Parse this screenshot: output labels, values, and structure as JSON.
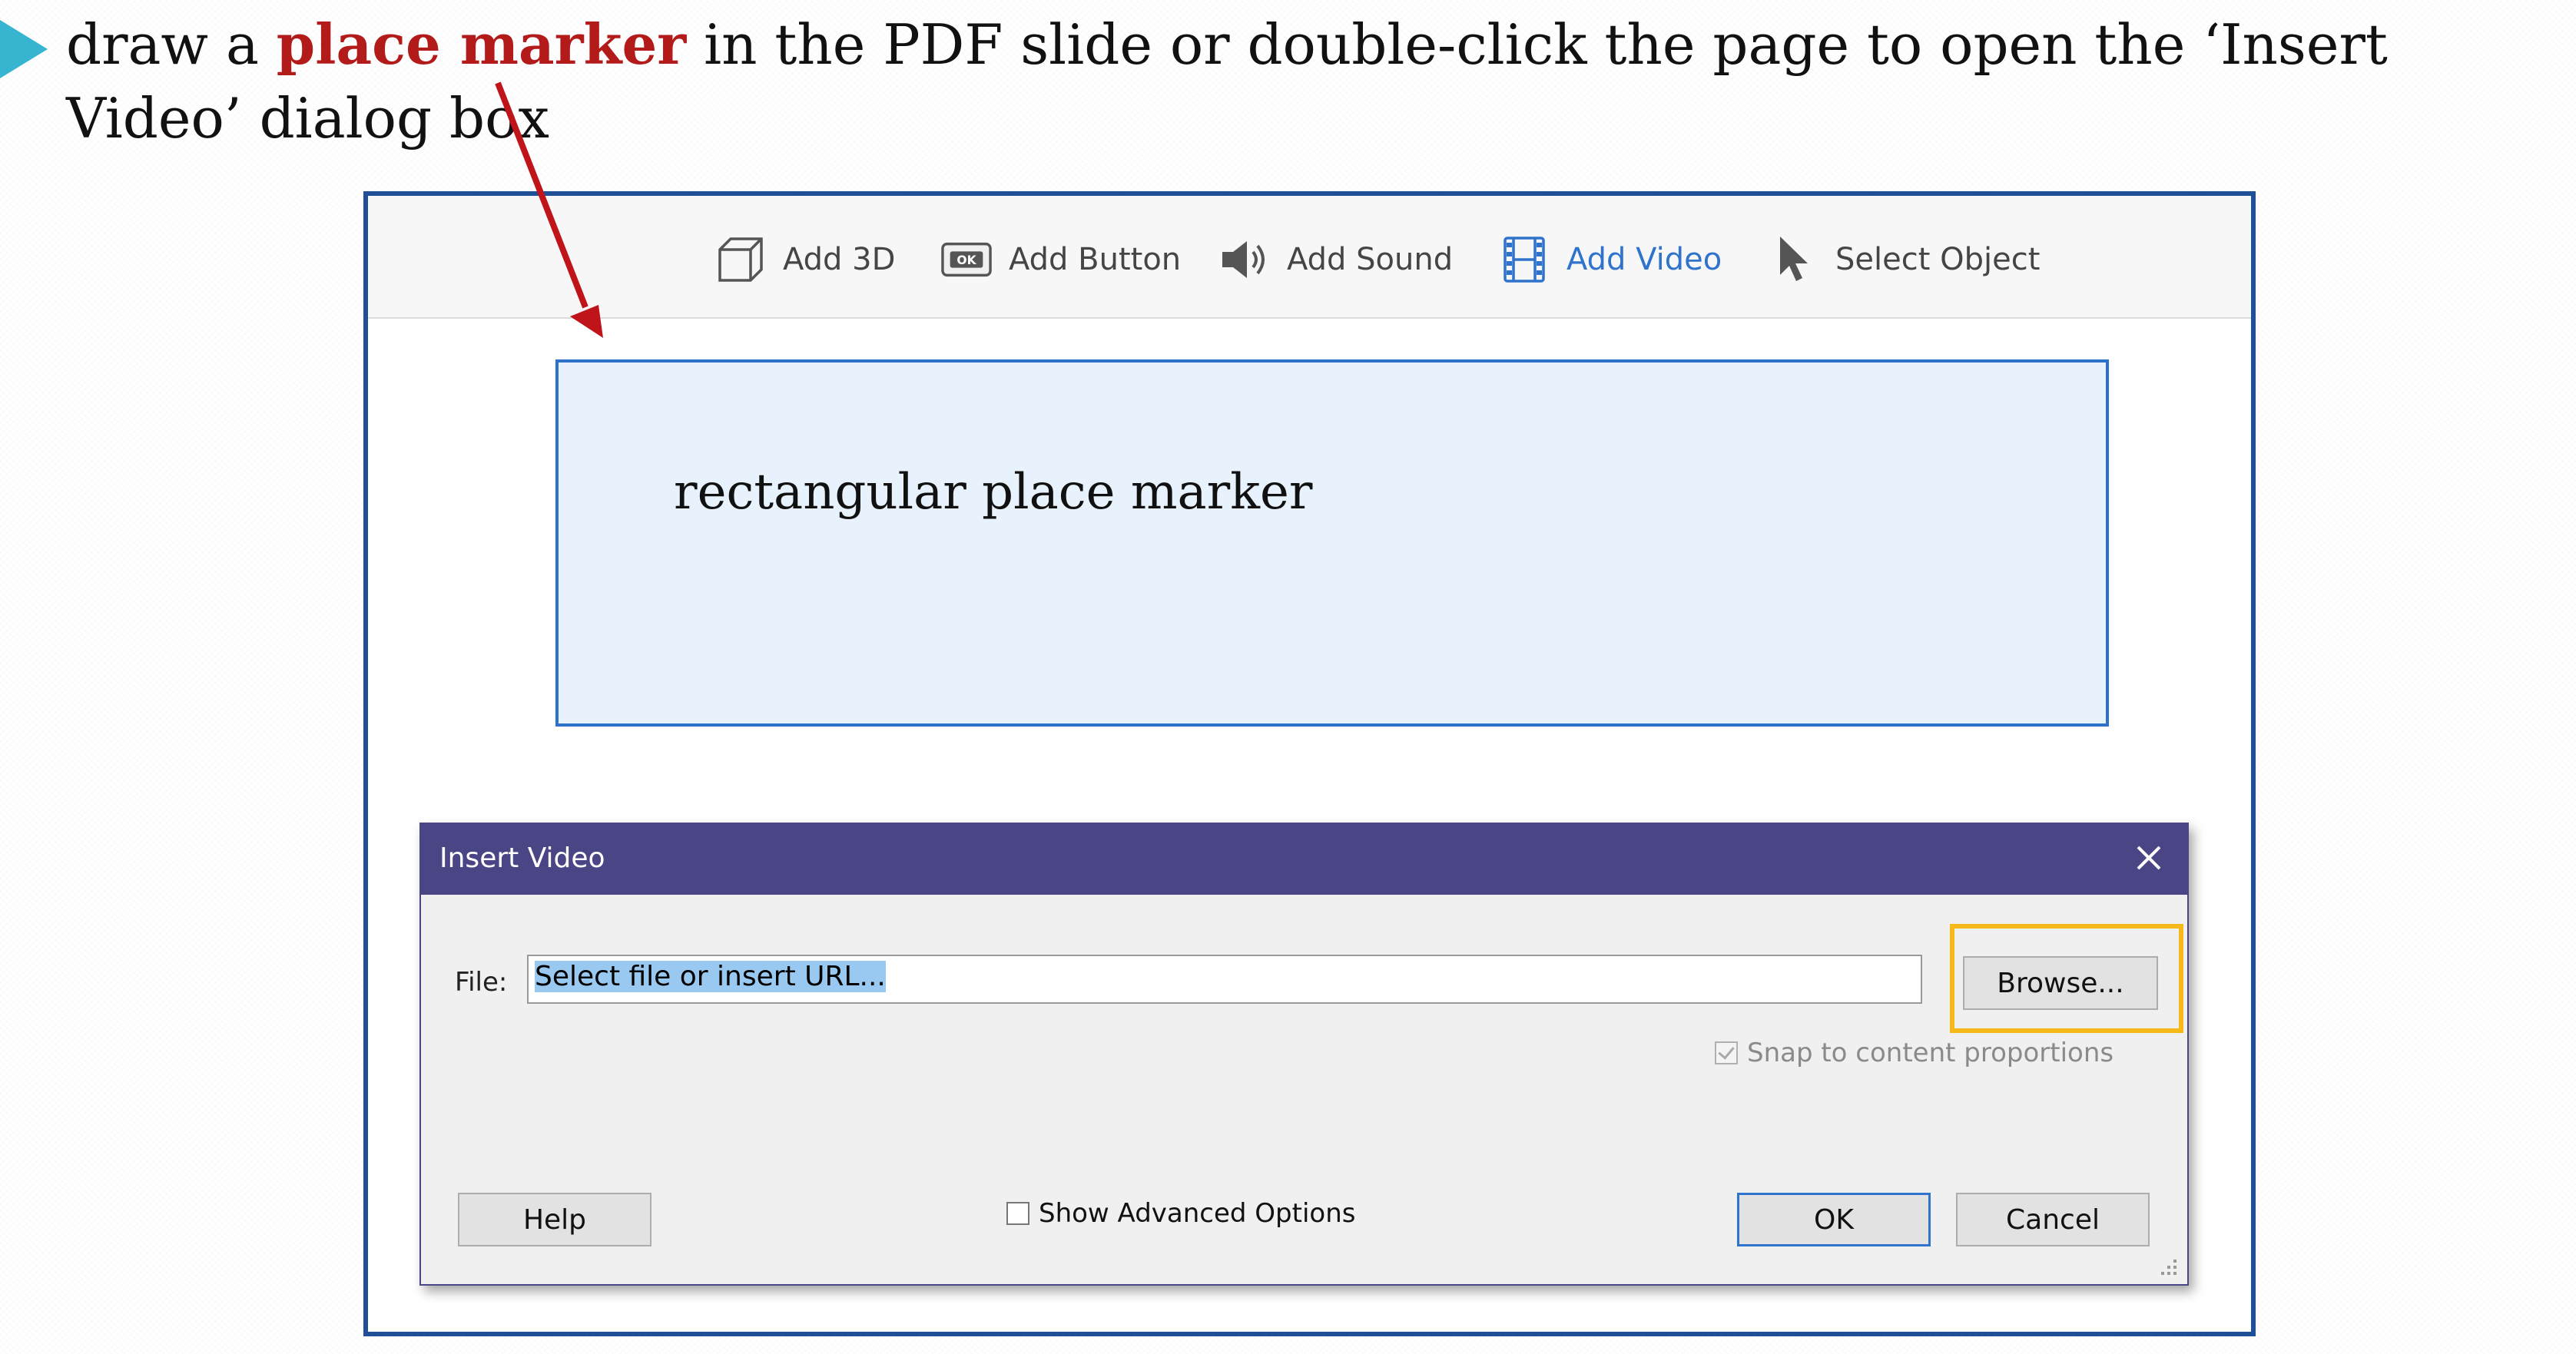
{
  "heading": {
    "before": "draw a ",
    "emphasis": "place marker",
    "after": " in the PDF slide or double-click the page to open the ‘Insert Video’ dialog box"
  },
  "toolbar": {
    "items": [
      {
        "label": "Add 3D",
        "icon": "cube-icon"
      },
      {
        "label": "Add Button",
        "icon": "ok-button-icon"
      },
      {
        "label": "Add Sound",
        "icon": "speaker-icon"
      },
      {
        "label": "Add Video",
        "icon": "film-icon",
        "active": true
      },
      {
        "label": "Select Object",
        "icon": "pointer-icon"
      }
    ]
  },
  "marker": {
    "label": "rectangular place marker"
  },
  "dialog": {
    "title": "Insert Video",
    "file_label": "File:",
    "file_value": "Select file or insert URL...",
    "browse_label": "Browse...",
    "snap_label": "Snap to content proportions",
    "snap_checked": true,
    "help_label": "Help",
    "advanced_label": "Show Advanced Options",
    "advanced_checked": false,
    "ok_label": "OK",
    "cancel_label": "Cancel"
  },
  "colors": {
    "bullet": "#36b4d0",
    "emphasis": "#b31b1b",
    "arrow": "#c0141b",
    "frame": "#1e4f97",
    "active_tool": "#2f73cc",
    "dialog_title_bar": "#4a4585",
    "highlight": "#f7b917"
  }
}
